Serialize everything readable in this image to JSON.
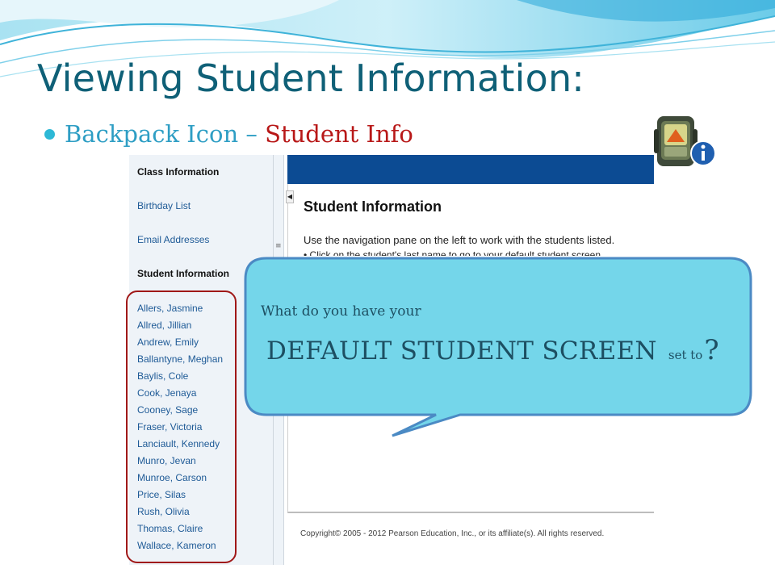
{
  "slide": {
    "title": "Viewing Student Information:",
    "bullet_main": "Backpack Icon –",
    "bullet_accent": "Student Info",
    "icon": "backpack-info-icon",
    "colors": {
      "title": "#0f6077",
      "bullet": "#2e9ec4",
      "accent": "#b81818"
    }
  },
  "nav": {
    "class_info": "Class Information",
    "birthday_list": "Birthday List",
    "email_addresses": "Email Addresses",
    "student_info": "Student Information",
    "students": [
      "Allers, Jasmine",
      "Allred, Jillian",
      "Andrew, Emily",
      "Ballantyne, Meghan",
      "Baylis, Cole",
      "Cook, Jenaya",
      "Cooney, Sage",
      "Fraser, Victoria",
      "Lanciault, Kennedy",
      "Munro, Jevan",
      "Munroe, Carson",
      "Price, Silas",
      "Rush, Olivia",
      "Thomas, Claire",
      "Wallace, Kameron"
    ]
  },
  "content": {
    "title": "Student Information",
    "instruction": "Use the navigation pane on the left to work with the students listed.",
    "bullet": "• Click on the student's last name to go to your default student screen.",
    "copyright": "Copyright© 2005 - 2012 Pearson Education, Inc., or its affiliate(s). All rights reserved."
  },
  "callout": {
    "line1": "What do you have your",
    "big": "DEFAULT STUDENT SCREEN",
    "small": "set to",
    "question": "?"
  }
}
